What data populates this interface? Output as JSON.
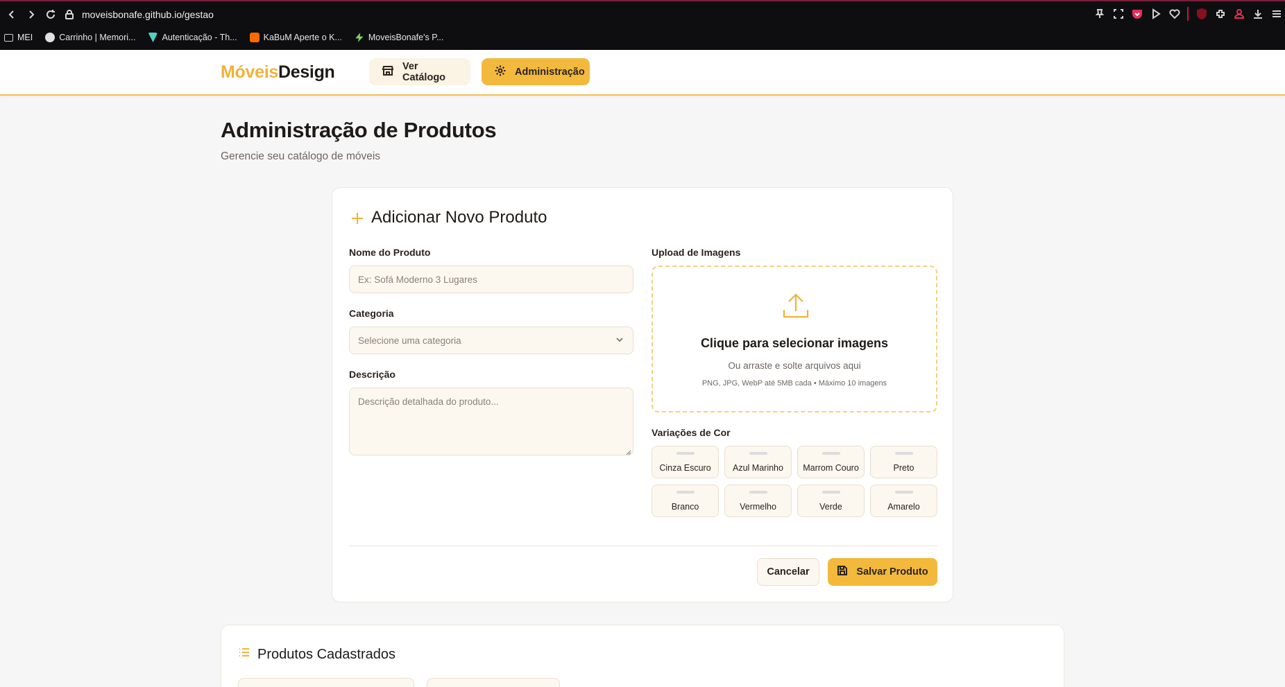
{
  "browser": {
    "url": "moveisbonafe.github.io/gestao",
    "bookmarks": [
      {
        "label": "MEI",
        "icon": "folder-icon",
        "color": "#cfcfcf"
      },
      {
        "label": "Carrinho | Memori...",
        "icon": "site-favicon",
        "color": "#e0e0e0"
      },
      {
        "label": "Autenticação - Th...",
        "icon": "vuetify-favicon",
        "color": "#4fd1c5"
      },
      {
        "label": "KaBuM Aperte o K...",
        "icon": "kabum-favicon",
        "color": "#ff6a00"
      },
      {
        "label": "MoveisBonafe's P...",
        "icon": "bolt-favicon",
        "color": "#7ed957"
      }
    ]
  },
  "header": {
    "logo_part1": "Móveis",
    "logo_part2": "Design",
    "catalog_label": "Ver Catálogo",
    "admin_label": "Administração",
    "accent": "#f3b93c"
  },
  "page": {
    "title": "Administração de Produtos",
    "subtitle": "Gerencie seu catálogo de móveis"
  },
  "form": {
    "title": "Adicionar Novo Produto",
    "name_label": "Nome do Produto",
    "name_placeholder": "Ex: Sofá Moderno 3 Lugares",
    "category_label": "Categoria",
    "category_placeholder": "Selecione uma categoria",
    "description_label": "Descrição",
    "description_placeholder": "Descrição detalhada do produto...",
    "upload_label": "Upload de Imagens",
    "upload_title": "Clique para selecionar imagens",
    "upload_sub": "Ou arraste e solte arquivos aqui",
    "upload_note": "PNG, JPG, WebP até 5MB cada • Máximo 10 imagens",
    "colors_label": "Variações de Cor",
    "colors": [
      "Cinza Escuro",
      "Azul Marinho",
      "Marrom Couro",
      "Preto",
      "Branco",
      "Vermelho",
      "Verde",
      "Amarelo"
    ],
    "cancel_label": "Cancelar",
    "save_label": "Salvar Produto"
  },
  "products": {
    "title": "Produtos Cadastrados"
  }
}
